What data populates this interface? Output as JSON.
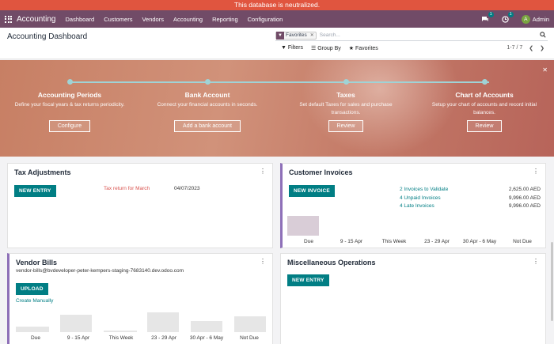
{
  "banner": "This database is neutralized.",
  "navbar": {
    "app_name": "Accounting",
    "menu": [
      "Dashboard",
      "Customers",
      "Vendors",
      "Accounting",
      "Reporting",
      "Configuration"
    ],
    "chat_count": "1",
    "activity_count": "1",
    "avatar_letter": "A",
    "user": "Admin"
  },
  "control": {
    "title": "Accounting Dashboard",
    "facet": "Favorites",
    "search_placeholder": "Search...",
    "filters": "Filters",
    "group_by": "Group By",
    "favorites": "Favorites",
    "pager": "1-7 / 7"
  },
  "onboarding": {
    "steps": [
      {
        "title": "Accounting Periods",
        "desc": "Define your fiscal years & tax returns periodicity.",
        "button": "Configure"
      },
      {
        "title": "Bank Account",
        "desc": "Connect your financial accounts in seconds.",
        "button": "Add a bank account"
      },
      {
        "title": "Taxes",
        "desc": "Set default Taxes for sales and purchase transactions.",
        "button": "Review"
      },
      {
        "title": "Chart of Accounts",
        "desc": "Setup your chart of accounts and record initial balances.",
        "button": "Review"
      }
    ]
  },
  "cards": {
    "tax": {
      "title": "Tax Adjustments",
      "button": "NEW ENTRY",
      "item": "Tax return for March",
      "date": "04/07/2023"
    },
    "customer": {
      "title": "Customer Invoices",
      "button": "NEW INVOICE",
      "rows": [
        {
          "label": "2 Invoices to Validate",
          "amount": "2,625.00 AED"
        },
        {
          "label": "4 Unpaid Invoices",
          "amount": "9,996.00 AED"
        },
        {
          "label": "4 Late Invoices",
          "amount": "9,996.00 AED"
        }
      ],
      "chart_labels": [
        "Due",
        "9 - 15 Apr",
        "This Week",
        "23 - 29 Apr",
        "30 Apr - 6 May",
        "Not Due"
      ]
    },
    "vendor": {
      "title": "Vendor Bills",
      "email": "vendor-bills@bvdeveloper-peter-kempers-staging-7683140.dev.odoo.com",
      "button": "UPLOAD",
      "create": "Create Manually",
      "chart_labels": [
        "Due",
        "9 - 15 Apr",
        "This Week",
        "23 - 29 Apr",
        "30 Apr - 6 May",
        "Not Due"
      ]
    },
    "misc": {
      "title": "Miscellaneous Operations",
      "button": "NEW ENTRY"
    }
  },
  "colors": {
    "brand": "#714b67",
    "teal": "#017e84",
    "banner": "#e0553f"
  }
}
